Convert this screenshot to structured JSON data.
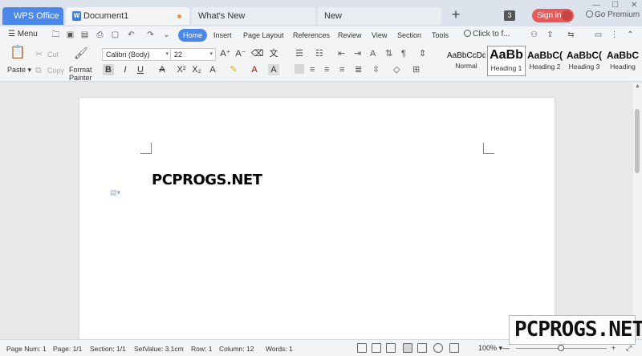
{
  "titlebar": {
    "tabs": [
      {
        "label": "WPS Office"
      },
      {
        "label": "Document1"
      },
      {
        "label": "What's New"
      },
      {
        "label": "New"
      }
    ],
    "count_badge": "3",
    "signin_label": "Sign in",
    "premium_label": "Go Premium"
  },
  "menu": {
    "menu_label": "Menu",
    "tabs": [
      "Home",
      "Insert",
      "Page Layout",
      "References",
      "Review",
      "View",
      "Section",
      "Tools"
    ],
    "active_tab": "Home",
    "search_placeholder": "Click to f..."
  },
  "ribbon": {
    "paste_label": "Paste",
    "cut_label": "Cut",
    "copy_label": "Copy",
    "format_painter_line1": "Format",
    "format_painter_line2": "Painter",
    "font_name": "Calibri (Body)",
    "font_size": "22",
    "styles": [
      {
        "preview": "AaBbCcDd",
        "name": "Normal"
      },
      {
        "preview": "AaBb",
        "name": "Heading 1"
      },
      {
        "preview": "AaBbC(",
        "name": "Heading 2"
      },
      {
        "preview": "AaBbC(",
        "name": "Heading 3"
      },
      {
        "preview": "AaBbC",
        "name": "Heading"
      }
    ]
  },
  "document": {
    "text": "PCPROGS.NET"
  },
  "status": {
    "page_num": "Page Num: 1",
    "page": "Page: 1/1",
    "section": "Section: 1/1",
    "setvalue": "SetValue: 3.1cm",
    "row": "Row: 1",
    "column": "Column: 12",
    "words": "Words: 1",
    "zoom": "100%"
  },
  "watermark": {
    "text": "PCPROGS.NET"
  },
  "colors": {
    "accent": "#4a88ec",
    "signin": "#e85a5a",
    "tab_bar": "#dde3ec"
  }
}
